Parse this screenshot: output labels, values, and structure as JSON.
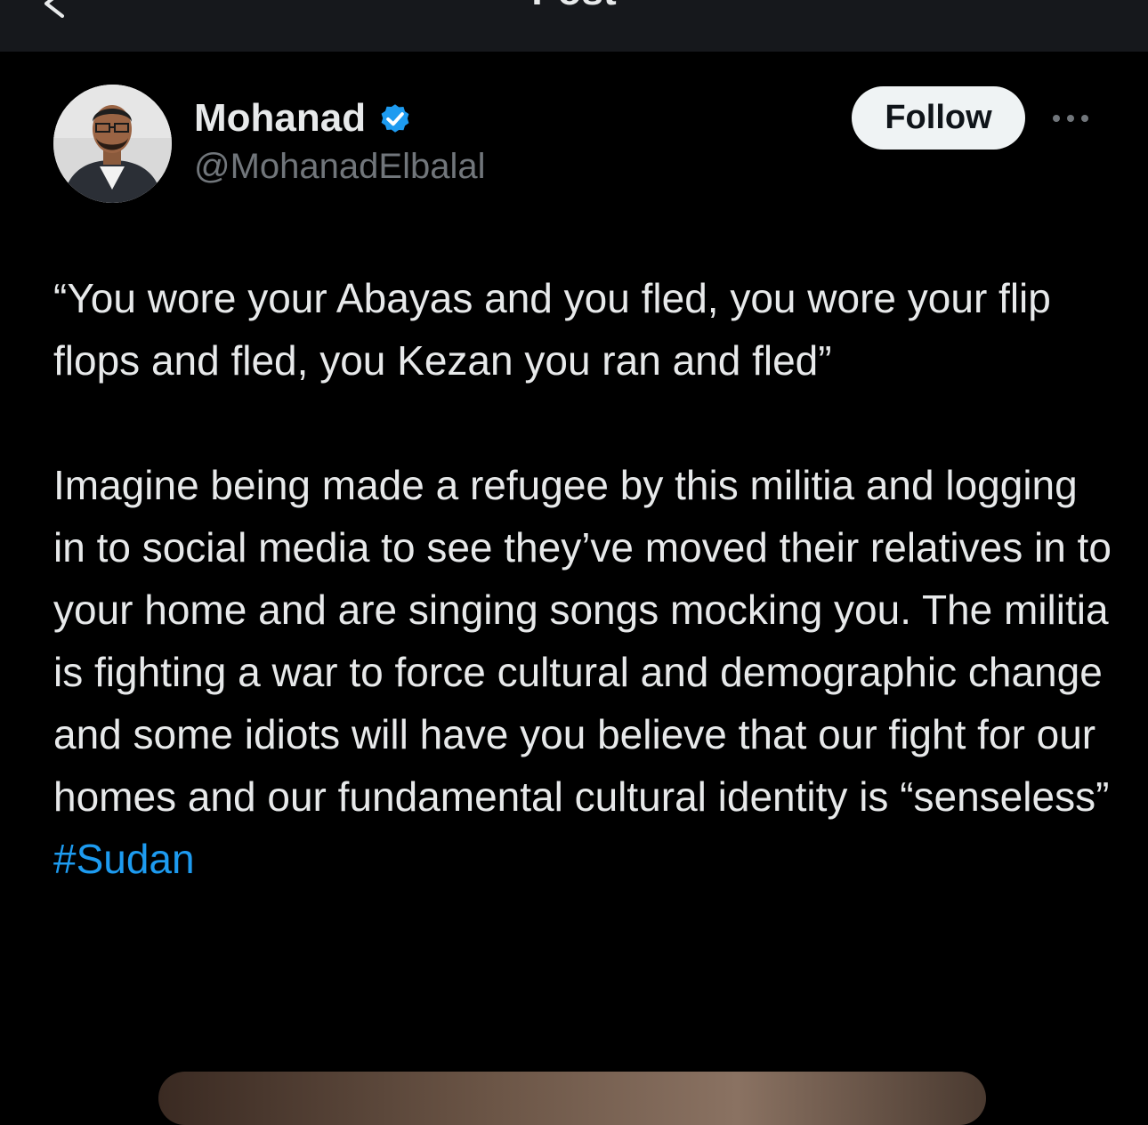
{
  "header": {
    "title": "Post"
  },
  "author": {
    "name": "Mohanad",
    "handle": "@MohanadElbalal",
    "verified": true
  },
  "actions": {
    "follow_label": "Follow"
  },
  "post": {
    "paragraph1": "“You wore your Abayas and you fled, you wore your flip flops and fled, you Kezan you ran and fled”",
    "paragraph2": "Imagine being made a refugee by this militia and logging in to social media to see they’ve moved their relatives in to your home and are singing songs mocking you. The militia is fighting a war to force cultural and demographic change and some idiots will have you believe that our fight for our homes and our fundamental cultural identity is “senseless”",
    "hashtag": "#Sudan"
  },
  "colors": {
    "background": "#000000",
    "header_bg": "#16181c",
    "text": "#e7e9ea",
    "secondary_text": "#71767b",
    "link": "#1d9bf0",
    "verified_badge": "#1d9bf0",
    "follow_button_bg": "#eff3f4"
  },
  "icons": {
    "back": "back-arrow-icon",
    "verified": "verified-badge-icon",
    "more": "more-options-icon"
  }
}
